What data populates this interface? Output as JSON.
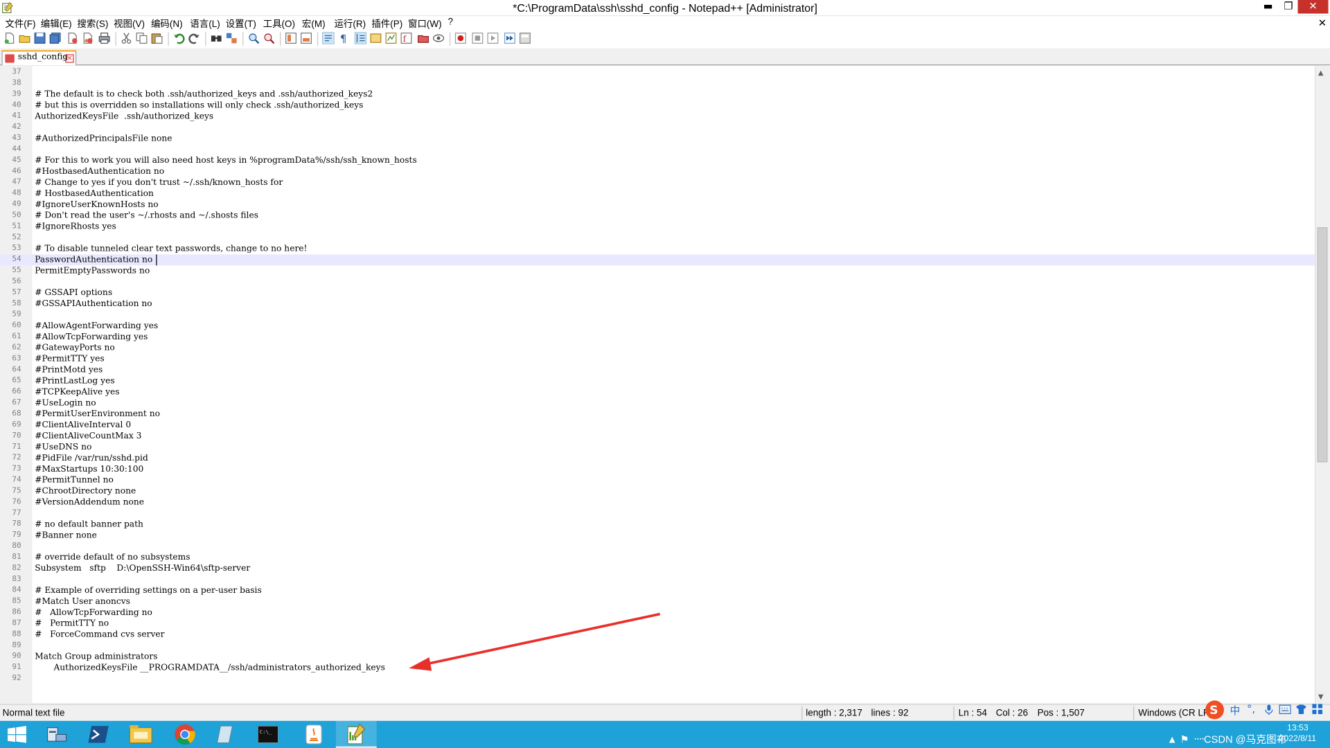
{
  "window": {
    "title": "*C:\\ProgramData\\ssh\\sshd_config - Notepad++ [Administrator]",
    "minimize_glyph": "▬",
    "maximize_glyph": "❐",
    "close_glyph": "✕"
  },
  "menu": {
    "items": [
      "文件(F)",
      "编辑(E)",
      "搜索(S)",
      "视图(V)",
      "编码(N)",
      "语言(L)",
      "设置(T)",
      "工具(O)",
      "宏(M)",
      "运行(R)",
      "插件(P)",
      "窗口(W)",
      "?"
    ],
    "close_glyph": "✕"
  },
  "toolbar": {
    "icons": [
      "new-file-icon",
      "open-file-icon",
      "save-icon",
      "save-all-icon",
      "close-icon",
      "close-all-icon",
      "print-icon",
      "cut-icon",
      "copy-icon",
      "paste-icon",
      "undo-icon",
      "redo-icon",
      "find-icon",
      "replace-icon",
      "zoom-in-icon",
      "zoom-out-icon",
      "sync-vertical-icon",
      "sync-horizontal-icon",
      "word-wrap-icon",
      "show-all-chars-icon",
      "indent-guide-icon",
      "user-language-icon",
      "doc-map-icon",
      "function-list-icon",
      "folder-as-workspace-icon",
      "monitoring-icon",
      "record-macro-icon",
      "stop-macro-icon",
      "play-macro-icon",
      "run-macro-multiple-icon",
      "save-macro-icon"
    ]
  },
  "tab": {
    "label": "sshd_config",
    "close_glyph": "×"
  },
  "editor": {
    "current_line": 54,
    "lines": [
      {
        "n": "37",
        "t": ""
      },
      {
        "n": "38",
        "t": ""
      },
      {
        "n": "39",
        "t": "# The default is to check both .ssh/authorized_keys and .ssh/authorized_keys2"
      },
      {
        "n": "40",
        "t": "# but this is overridden so installations will only check .ssh/authorized_keys"
      },
      {
        "n": "41",
        "t": "AuthorizedKeysFile  .ssh/authorized_keys"
      },
      {
        "n": "42",
        "t": ""
      },
      {
        "n": "43",
        "t": "#AuthorizedPrincipalsFile none"
      },
      {
        "n": "44",
        "t": ""
      },
      {
        "n": "45",
        "t": "# For this to work you will also need host keys in %programData%/ssh/ssh_known_hosts"
      },
      {
        "n": "46",
        "t": "#HostbasedAuthentication no"
      },
      {
        "n": "47",
        "t": "# Change to yes if you don't trust ~/.ssh/known_hosts for"
      },
      {
        "n": "48",
        "t": "# HostbasedAuthentication"
      },
      {
        "n": "49",
        "t": "#IgnoreUserKnownHosts no"
      },
      {
        "n": "50",
        "t": "# Don't read the user's ~/.rhosts and ~/.shosts files"
      },
      {
        "n": "51",
        "t": "#IgnoreRhosts yes"
      },
      {
        "n": "52",
        "t": ""
      },
      {
        "n": "53",
        "t": "# To disable tunneled clear text passwords, change to no here!"
      },
      {
        "n": "54",
        "t": "PasswordAuthentication no"
      },
      {
        "n": "55",
        "t": "PermitEmptyPasswords no"
      },
      {
        "n": "56",
        "t": ""
      },
      {
        "n": "57",
        "t": "# GSSAPI options"
      },
      {
        "n": "58",
        "t": "#GSSAPIAuthentication no"
      },
      {
        "n": "59",
        "t": ""
      },
      {
        "n": "60",
        "t": "#AllowAgentForwarding yes"
      },
      {
        "n": "61",
        "t": "#AllowTcpForwarding yes"
      },
      {
        "n": "62",
        "t": "#GatewayPorts no"
      },
      {
        "n": "63",
        "t": "#PermitTTY yes"
      },
      {
        "n": "64",
        "t": "#PrintMotd yes"
      },
      {
        "n": "65",
        "t": "#PrintLastLog yes"
      },
      {
        "n": "66",
        "t": "#TCPKeepAlive yes"
      },
      {
        "n": "67",
        "t": "#UseLogin no"
      },
      {
        "n": "68",
        "t": "#PermitUserEnvironment no"
      },
      {
        "n": "69",
        "t": "#ClientAliveInterval 0"
      },
      {
        "n": "70",
        "t": "#ClientAliveCountMax 3"
      },
      {
        "n": "71",
        "t": "#UseDNS no"
      },
      {
        "n": "72",
        "t": "#PidFile /var/run/sshd.pid"
      },
      {
        "n": "73",
        "t": "#MaxStartups 10:30:100"
      },
      {
        "n": "74",
        "t": "#PermitTunnel no"
      },
      {
        "n": "75",
        "t": "#ChrootDirectory none"
      },
      {
        "n": "76",
        "t": "#VersionAddendum none"
      },
      {
        "n": "77",
        "t": ""
      },
      {
        "n": "78",
        "t": "# no default banner path"
      },
      {
        "n": "79",
        "t": "#Banner none"
      },
      {
        "n": "80",
        "t": ""
      },
      {
        "n": "81",
        "t": "# override default of no subsystems"
      },
      {
        "n": "82",
        "t": "Subsystem   sftp    D:\\OpenSSH-Win64\\sftp-server"
      },
      {
        "n": "83",
        "t": ""
      },
      {
        "n": "84",
        "t": "# Example of overriding settings on a per-user basis"
      },
      {
        "n": "85",
        "t": "#Match User anoncvs"
      },
      {
        "n": "86",
        "t": "#   AllowTcpForwarding no"
      },
      {
        "n": "87",
        "t": "#   PermitTTY no"
      },
      {
        "n": "88",
        "t": "#   ForceCommand cvs server"
      },
      {
        "n": "89",
        "t": ""
      },
      {
        "n": "90",
        "t": "Match Group administrators"
      },
      {
        "n": "91",
        "t": "       AuthorizedKeysFile __PROGRAMDATA__/ssh/administrators_authorized_keys"
      },
      {
        "n": "92",
        "t": ""
      }
    ]
  },
  "annotation": {
    "arrow_color": "#e8302a"
  },
  "statusbar": {
    "file_type": "Normal text file",
    "length": "length : 2,317",
    "lines": "lines : 92",
    "ln": "Ln : 54",
    "col": "Col : 26",
    "pos": "Pos : 1,507",
    "eol": "Windows (CR LF)"
  },
  "ime": {
    "icons": [
      "sogou-logo-icon",
      "chinese-mode-icon",
      "punctuation-icon",
      "microphone-icon",
      "keyboard-icon",
      "skin-icon",
      "toolbox-icon"
    ],
    "labels": [
      "中",
      "°,"
    ]
  },
  "taskbar": {
    "items": [
      "start-button",
      "server-manager-icon",
      "powershell-icon",
      "file-explorer-icon",
      "chrome-icon",
      "notepad-icon",
      "cmd-icon",
      "java-icon",
      "notepadpp-icon"
    ],
    "active_index": 8,
    "tray_text": "▲  ⚑  ᠁CSDN @马克图布",
    "time": "13:53",
    "date": "2022/8/11"
  },
  "colors": {
    "taskbar": "#1ea2d8",
    "current_line": "#e8e8ff",
    "close_button": "#c7312b",
    "tab_accent": "#f4b13e"
  }
}
